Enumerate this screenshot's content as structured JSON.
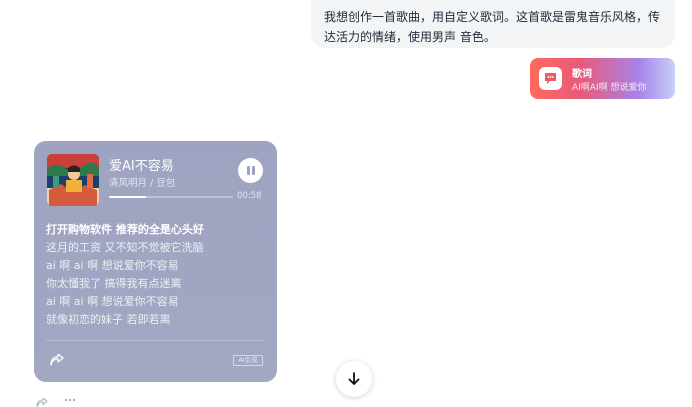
{
  "user_message": {
    "text": "我想创作一首歌曲，用自定义歌词。这首歌是雷鬼音乐风格，传达活力的情绪，使用男声 音色。"
  },
  "lyric_chip": {
    "title": "歌词",
    "subtitle": "AI啊AI啊 想说爱你",
    "icon": "chat-bubble-icon"
  },
  "music_card": {
    "song_title": "爱AI不容易",
    "artist": "清风明月 / 豆包",
    "progress_fraction": 0.3,
    "time": "00:58",
    "lyrics": [
      "打开购物软件 推荐的全是心头好",
      "这月的工资 又不知不觉被它洗脑",
      "ai 啊 ai 啊 想说爱你不容易",
      "你太懂我了 搞得我有点迷离",
      "ai 啊 ai 啊 想说爱你不容易",
      "就像初恋的妹子 若即若离"
    ],
    "active_lyric_index": 0,
    "ai_badge": "AI生成"
  },
  "colors": {
    "card_bg": "#9ea3c1",
    "chip_gradient_start": "#ff6a5c",
    "chip_gradient_end": "#c8cff8"
  }
}
